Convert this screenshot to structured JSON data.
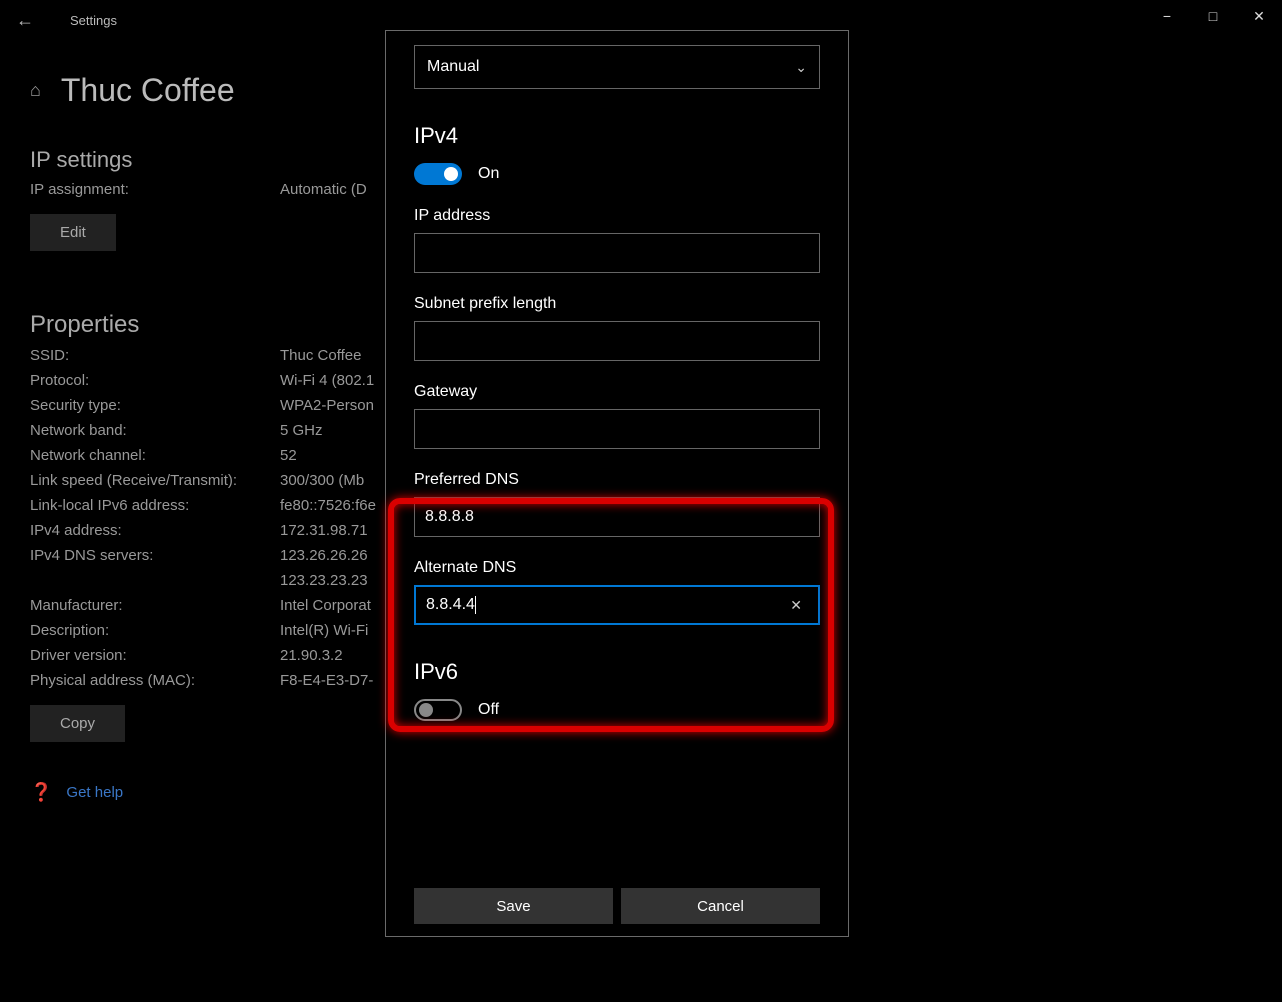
{
  "titlebar": {
    "title": "Settings"
  },
  "page": {
    "title": "Thuc Coffee",
    "ip_settings_heading": "IP settings",
    "ip_assignment_label": "IP assignment:",
    "ip_assignment_value": "Automatic (D",
    "edit_button": "Edit",
    "properties_heading": "Properties",
    "props": [
      {
        "k": "SSID:",
        "v": "Thuc Coffee"
      },
      {
        "k": "Protocol:",
        "v": "Wi-Fi 4 (802.1"
      },
      {
        "k": "Security type:",
        "v": "WPA2-Person"
      },
      {
        "k": "Network band:",
        "v": "5 GHz"
      },
      {
        "k": "Network channel:",
        "v": "52"
      },
      {
        "k": "Link speed (Receive/Transmit):",
        "v": "300/300 (Mb"
      },
      {
        "k": "Link-local IPv6 address:",
        "v": "fe80::7526:f6e"
      },
      {
        "k": "IPv4 address:",
        "v": "172.31.98.71"
      },
      {
        "k": "IPv4 DNS servers:",
        "v": "123.26.26.26"
      },
      {
        "k": "",
        "v": "123.23.23.23"
      },
      {
        "k": "Manufacturer:",
        "v": "Intel Corporat"
      },
      {
        "k": "Description:",
        "v": "Intel(R) Wi-Fi"
      },
      {
        "k": "Driver version:",
        "v": "21.90.3.2"
      },
      {
        "k": "Physical address (MAC):",
        "v": "F8-E4-E3-D7-"
      }
    ],
    "copy_button": "Copy",
    "help_link": "Get help"
  },
  "dialog": {
    "mode_select": "Manual",
    "ipv4_heading": "IPv4",
    "ipv4_toggle": "On",
    "ip_address_label": "IP address",
    "ip_address_value": "",
    "subnet_label": "Subnet prefix length",
    "subnet_value": "",
    "gateway_label": "Gateway",
    "gateway_value": "",
    "preferred_dns_label": "Preferred DNS",
    "preferred_dns_value": "8.8.8.8",
    "alternate_dns_label": "Alternate DNS",
    "alternate_dns_value": "8.8.4.4",
    "ipv6_heading": "IPv6",
    "ipv6_toggle": "Off",
    "save_button": "Save",
    "cancel_button": "Cancel"
  }
}
